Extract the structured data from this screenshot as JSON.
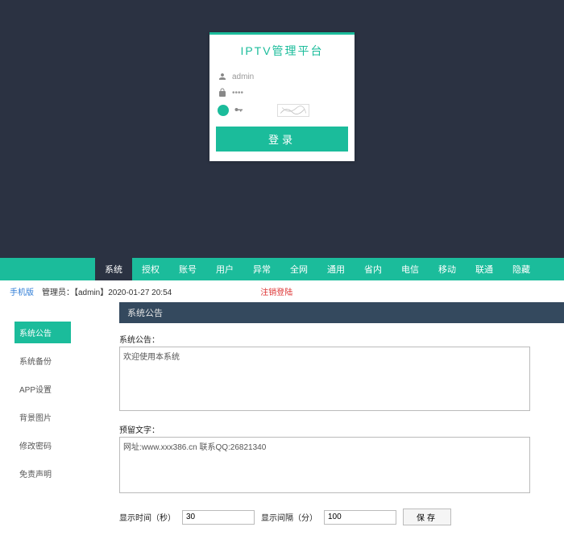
{
  "login": {
    "title": "IPTV管理平台",
    "username_value": "admin",
    "password_value": "••••",
    "captcha_value": "",
    "button_label": "登录"
  },
  "topnav": {
    "items": [
      "系统",
      "授权",
      "账号",
      "用户",
      "异常",
      "全网",
      "通用",
      "省内",
      "电信",
      "移动",
      "联通",
      "隐藏"
    ],
    "active_index": 0
  },
  "infobar": {
    "mobile": "手机版",
    "admin": "管理员：【admin】2020-01-27 20:54",
    "logout": "注销登陆"
  },
  "sidebar": {
    "items": [
      "系统公告",
      "系统备份",
      "APP设置",
      "背景图片",
      "修改密码",
      "免责声明"
    ],
    "active_index": 0
  },
  "panel": {
    "header": "系统公告",
    "notice_label": "系统公告：",
    "notice_value": "欢迎使用本系统",
    "reserve_label": "预留文字：",
    "reserve_value": "网址:www.xxx386.cn 联系QQ:26821340",
    "display_time_label": "显示时间（秒）",
    "display_time_value": "30",
    "display_interval_label": "显示间隔（分）",
    "display_interval_value": "100",
    "save_label": "保存"
  }
}
